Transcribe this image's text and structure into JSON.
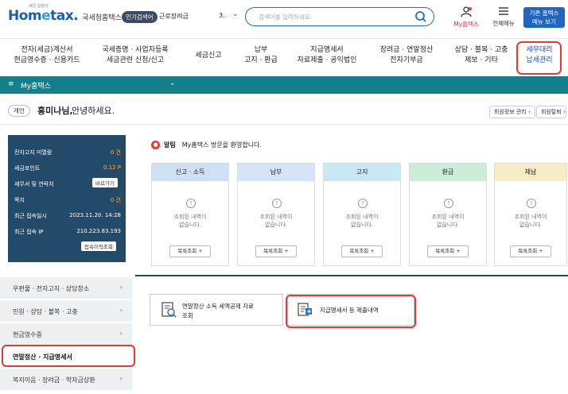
{
  "header": {
    "logo_main_left": "Hom",
    "logo_main_e": "e",
    "logo_main_right": "tax.",
    "logo_small": "세금 알림이",
    "logo_sub": "국세청홈택스",
    "popular_badge": "인기검색어",
    "popular_word": "근로장려금",
    "popular_rank": "3.",
    "search_placeholder": "검색어를 입력하세요.",
    "my_hometax": "My홈택스",
    "all_menu": "전체메뉴",
    "old_menu_line1": "기존 홈택스",
    "old_menu_line2": "메뉴 보기"
  },
  "gnb": [
    {
      "line1": "전자(세금)계산서",
      "line2": "현금영수증 · 신용카드"
    },
    {
      "line1": "국세증명 · 사업자등록",
      "line2": "세금관련 신청/신고"
    },
    {
      "line1": "세금신고",
      "line2": ""
    },
    {
      "line1": "납부",
      "line2": "고지 · 환급"
    },
    {
      "line1": "지급명세서",
      "line2": "자료제출 · 공익법인"
    },
    {
      "line1": "장려금 · 연말정산",
      "line2": "전자기부금"
    },
    {
      "line1": "상담 · 불복 · 고충",
      "line2": "제보 · 기타"
    },
    {
      "line1": "세무대리",
      "line2": "납세관리"
    }
  ],
  "tealbar": {
    "menu_icon": "≡",
    "title": "My홈택스"
  },
  "greeting": {
    "badge": "개인",
    "name": "홍미나님,",
    "message": "안녕하세요.",
    "btn_info": "회원정보 관리 ›",
    "btn_member": "회원탈퇴 ›"
  },
  "info": [
    {
      "key": "전자고지 미열람",
      "value": "0 건"
    },
    {
      "key": "세금포인트",
      "value": "0.12 P"
    },
    {
      "key": "세무서 및 연락처",
      "value": ""
    },
    {
      "key": "쪽지",
      "value": "0 건"
    },
    {
      "key": "최근 접속일시",
      "value": "2023.11.20. 14:28"
    },
    {
      "key": "최근 접속 IP",
      "value": "210.223.83.193"
    }
  ],
  "info_btn_view": "바로가기",
  "info_btn_history": "접속이력조회",
  "notice": {
    "label": "알림",
    "text": "My홈택스 방문을 환영합니다."
  },
  "cards": [
    {
      "title": "신고 · 소득",
      "color": "#cfe0f4",
      "msg1": "조회된 내역이",
      "msg2": "없습니다.",
      "btn": "목록조회 +"
    },
    {
      "title": "납부",
      "color": "#d5e4f7",
      "msg1": "조회된 내역이",
      "msg2": "없습니다.",
      "btn": "목록조회 +"
    },
    {
      "title": "고지",
      "color": "#c8e9f3",
      "msg1": "조회된 내역이",
      "msg2": "없습니다.",
      "btn": "목록조회 +"
    },
    {
      "title": "환급",
      "color": "#cdeed6",
      "msg1": "조회된 내역이",
      "msg2": "없습니다.",
      "btn": "목록조회 +"
    },
    {
      "title": "체납",
      "color": "#f6ecc6",
      "msg1": "조회된 내역이",
      "msg2": "없습니다.",
      "btn": "목록조회 +"
    }
  ],
  "leftnav": [
    {
      "label": "우편물 · 전자고지 · 상담창소"
    },
    {
      "label": "민원 · 상담 · 불복 · 고충"
    },
    {
      "label": "현금영수증"
    },
    {
      "label": "연말정산 · 지급명세서"
    },
    {
      "label": "복지이음 · 장려금 · 학자금상환"
    }
  ],
  "links": [
    {
      "line1": "연말정산 소득 세액공제 자료",
      "line2": "조회"
    },
    {
      "line1": "지급명세서 등 제출내역",
      "line2": ""
    }
  ],
  "colors": {
    "brand": "#1a5fb4",
    "teal": "#14808b",
    "navy": "#244a6a",
    "highlight": "#e8392f"
  }
}
